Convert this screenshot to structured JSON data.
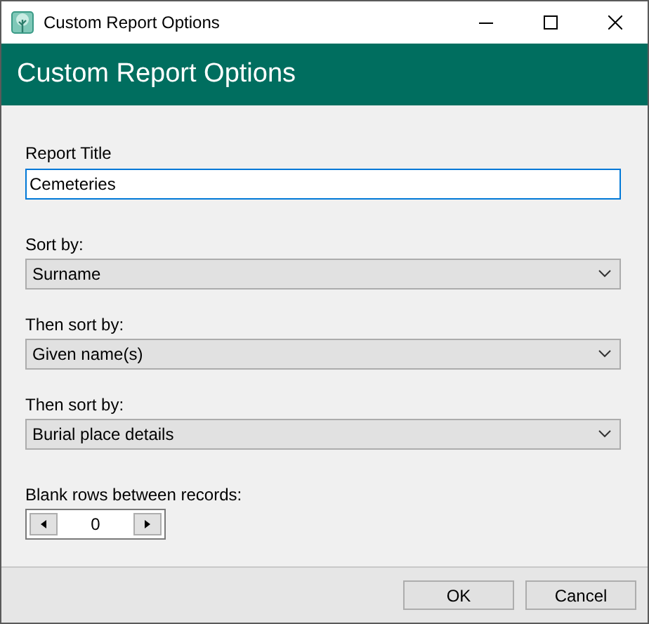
{
  "window": {
    "title": "Custom Report Options"
  },
  "header": {
    "title": "Custom Report Options"
  },
  "report_title": {
    "label": "Report Title",
    "value": "Cemeteries"
  },
  "sorts": [
    {
      "label": "Sort by:",
      "value": "Surname"
    },
    {
      "label": "Then sort by:",
      "value": "Given name(s)"
    },
    {
      "label": "Then sort by:",
      "value": "Burial place details"
    }
  ],
  "blank_rows": {
    "label": "Blank rows between records:",
    "value": "0"
  },
  "buttons": [
    "OK",
    "Cancel"
  ]
}
